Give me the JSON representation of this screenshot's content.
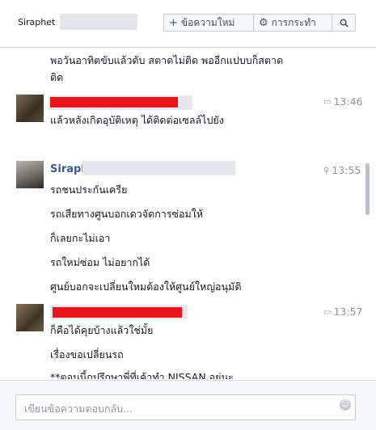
{
  "header": {
    "contact_name": "Siraphet",
    "new_message_label": "ข้อความใหม่",
    "new_message_icon": "+",
    "actions_label": "การกระทำ",
    "actions_icon": "⚙",
    "search_icon": "⌕"
  },
  "thread": {
    "block0": {
      "lines": [
        "พอวันอาทิตขับแล้วดับ สตาดไม่ติด  พออีกแปบบก็สตาด",
        "ติด"
      ]
    },
    "block1": {
      "time": "13:46",
      "lines": [
        "แล้วหลังเกิดอุบัติเหตุ ได้ติดต่อเซลล์ไปยัง"
      ]
    },
    "block2": {
      "sender": "Siraph",
      "time": "13:55",
      "lines": [
        "รถชนประกันเครีย",
        "รถเสียทางศูนบอกเดวจัดการซ่อมให้",
        "ก็เลยกะไม่เอา",
        "รถใหม่ซ่อม ไม่อยากได้",
        "ศูนย์บอกจะเปลี่ยนใหมต้องให้ศูนย์ใหญ่อนุมัติ"
      ]
    },
    "block3": {
      "time": "13:57",
      "lines": [
        "ก็คือได้คุยบ้างแล้วใช่มั้ย",
        "เรื่องขอเปลี่ยนรถ",
        "**ตอนนี้กูปรึกษาพี่ที่เค้าทำ NISSAN อยู่นะ"
      ]
    }
  },
  "composer": {
    "placeholder": "เขียนข้อความตอบกลับ...",
    "emoji_icon": "☺"
  },
  "colors": {
    "redaction_red": "#e8141b",
    "sender_blue": "#3b5998",
    "timestamp_grey": "#90949c"
  }
}
